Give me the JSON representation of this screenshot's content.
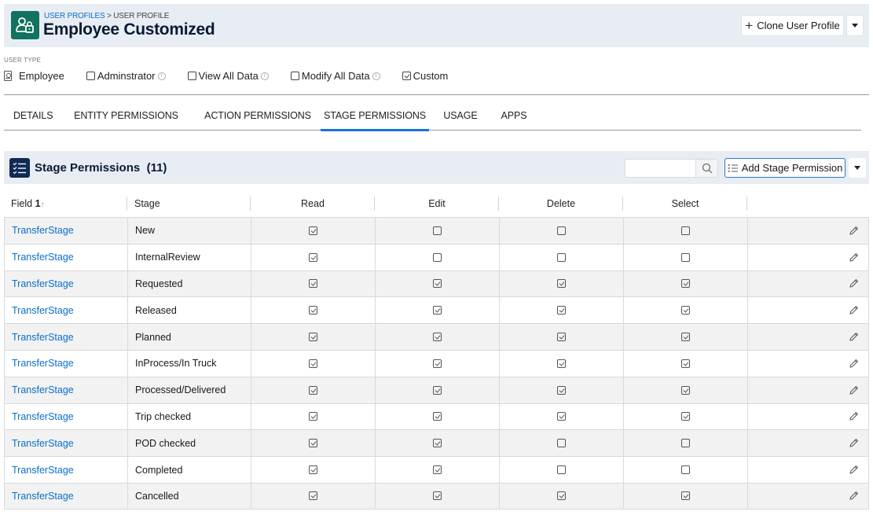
{
  "header": {
    "breadcrumb_parent": "USER PROFILES",
    "breadcrumb_separator": ">",
    "breadcrumb_current": "USER PROFILE",
    "title": "Employee Customized",
    "clone_button_label": "Clone User Profile",
    "icon": "user-lock-icon"
  },
  "user_type": {
    "label": "USER TYPE",
    "type_value": "Employee",
    "options": [
      {
        "label": "Adminstrator",
        "checked": false,
        "info": true
      },
      {
        "label": "View All Data",
        "checked": false,
        "info": true
      },
      {
        "label": "Modify All Data",
        "checked": false,
        "info": true
      },
      {
        "label": "Custom",
        "checked": true,
        "info": false
      }
    ]
  },
  "tabs": [
    {
      "label": "DETAILS",
      "active": false
    },
    {
      "label": "ENTITY PERMISSIONS",
      "active": false
    },
    {
      "label": "ACTION PERMISSIONS",
      "active": false
    },
    {
      "label": "STAGE PERMISSIONS",
      "active": true
    },
    {
      "label": "USAGE",
      "active": false
    },
    {
      "label": "APPS",
      "active": false
    }
  ],
  "section": {
    "title": "Stage Permissions",
    "count": "(11)",
    "search_placeholder": "",
    "search_value": "",
    "add_button_label": "Add Stage Permission"
  },
  "table": {
    "columns": [
      {
        "label": "Field",
        "sort": "1",
        "sort_dir": "↑"
      },
      {
        "label": "Stage"
      },
      {
        "label": "Read"
      },
      {
        "label": "Edit"
      },
      {
        "label": "Delete"
      },
      {
        "label": "Select"
      },
      {
        "label": ""
      }
    ],
    "rows": [
      {
        "field": "TransferStage",
        "stage": "New",
        "read": true,
        "edit": false,
        "delete": false,
        "select": false
      },
      {
        "field": "TransferStage",
        "stage": "InternalReview",
        "read": true,
        "edit": false,
        "delete": false,
        "select": false
      },
      {
        "field": "TransferStage",
        "stage": "Requested",
        "read": true,
        "edit": true,
        "delete": true,
        "select": true
      },
      {
        "field": "TransferStage",
        "stage": "Released",
        "read": true,
        "edit": true,
        "delete": true,
        "select": true
      },
      {
        "field": "TransferStage",
        "stage": "Planned",
        "read": true,
        "edit": true,
        "delete": true,
        "select": true
      },
      {
        "field": "TransferStage",
        "stage": "InProcess/In Truck",
        "read": true,
        "edit": true,
        "delete": true,
        "select": true
      },
      {
        "field": "TransferStage",
        "stage": "Processed/Delivered",
        "read": true,
        "edit": true,
        "delete": true,
        "select": true
      },
      {
        "field": "TransferStage",
        "stage": "Trip checked",
        "read": true,
        "edit": true,
        "delete": true,
        "select": true
      },
      {
        "field": "TransferStage",
        "stage": "POD checked",
        "read": true,
        "edit": true,
        "delete": false,
        "select": false
      },
      {
        "field": "TransferStage",
        "stage": "Completed",
        "read": true,
        "edit": true,
        "delete": false,
        "select": false
      },
      {
        "field": "TransferStage",
        "stage": "Cancelled",
        "read": true,
        "edit": true,
        "delete": true,
        "select": true
      }
    ]
  },
  "colors": {
    "header_bg": "#e8edf4",
    "profile_icon_bg": "#11725f",
    "section_icon_bg": "#0f2a54",
    "link": "#0b6fc7",
    "tab_active": "#1a73d4",
    "row_stripe": "#f2f2f2"
  }
}
